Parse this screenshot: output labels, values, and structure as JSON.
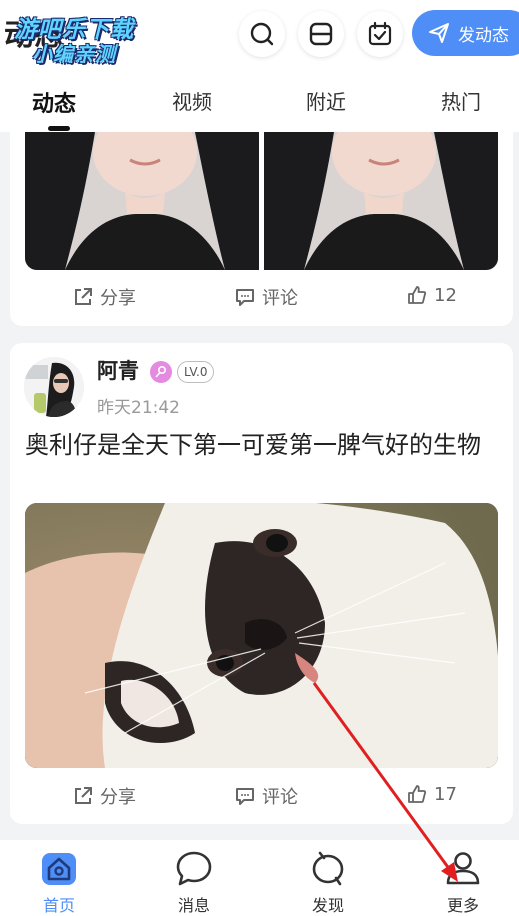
{
  "watermark": {
    "line1": "游吧乐下载",
    "line2": "小编亲测",
    "underlying_title": "动态"
  },
  "header": {
    "search_icon": "search-icon",
    "scan_icon": "scan-icon",
    "calendar_icon": "calendar-check-icon",
    "post_button_label": "发动态",
    "accent_color": "#4f8ef7"
  },
  "tabs": [
    {
      "label": "动态",
      "active": true
    },
    {
      "label": "视频",
      "active": false
    },
    {
      "label": "附近",
      "active": false
    },
    {
      "label": "热门",
      "active": false
    }
  ],
  "posts": [
    {
      "actions": {
        "share": "分享",
        "comment": "评论",
        "likes": "12"
      }
    },
    {
      "author": "阿青",
      "level": "LV.0",
      "time": "昨天21:42",
      "text": "奥利仔是全天下第一可爱第一脾气好的生物",
      "actions": {
        "share": "分享",
        "comment": "评论",
        "likes": "17"
      }
    }
  ],
  "bottom_nav": [
    {
      "label": "首页",
      "icon": "home-icon",
      "active": true
    },
    {
      "label": "消息",
      "icon": "message-icon",
      "active": false
    },
    {
      "label": "发现",
      "icon": "discover-icon",
      "active": false
    },
    {
      "label": "更多",
      "icon": "profile-icon",
      "active": false
    }
  ]
}
